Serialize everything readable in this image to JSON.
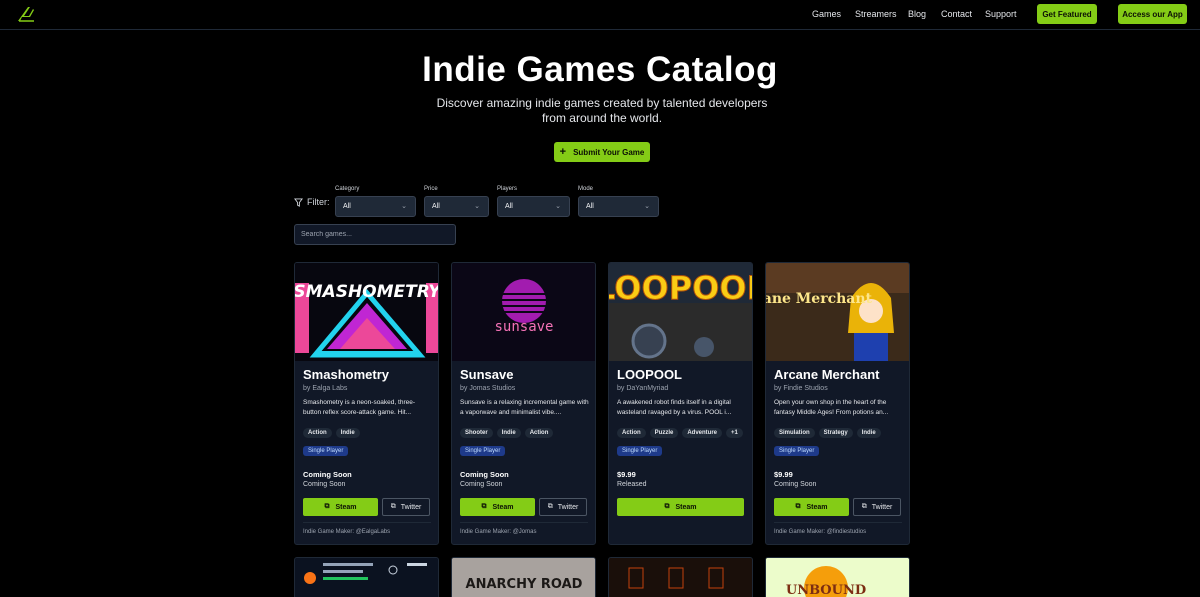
{
  "nav": {
    "items": [
      "Games",
      "Streamers",
      "Blog",
      "Contact",
      "Support"
    ],
    "get_featured": "Get Featured",
    "access_app": "Access our App"
  },
  "hero": {
    "title": "Indie Games Catalog",
    "subtitle": "Discover amazing indie games created by talented developers from around the world.",
    "submit": "Submit Your Game"
  },
  "filters": {
    "label": "Filter:",
    "groups": [
      {
        "label": "Category",
        "value": "All"
      },
      {
        "label": "Price",
        "value": "All"
      },
      {
        "label": "Players",
        "value": "All"
      },
      {
        "label": "Mode",
        "value": "All"
      }
    ],
    "search_placeholder": "Search games..."
  },
  "cards": [
    {
      "title": "Smashometry",
      "by": "by Ealga Labs",
      "desc": "Smashometry is a neon-soaked, three-button reflex score-attack game. Hit...",
      "tags": [
        "Action",
        "Indie"
      ],
      "mode": "Single Player",
      "price": "Coming Soon",
      "status": "Coming Soon",
      "steam": "Steam",
      "twitter": "Twitter",
      "maker": "Indie Game Maker: @EalgaLabs",
      "banner": "SMASHOMETRY"
    },
    {
      "title": "Sunsave",
      "by": "by Jomas Studios",
      "desc": "Sunsave is a relaxing incremental game with a vaporwave and minimalist vibe....",
      "tags": [
        "Shooter",
        "Indie",
        "Action"
      ],
      "mode": "Single Player",
      "price": "Coming Soon",
      "status": "Coming Soon",
      "steam": "Steam",
      "twitter": "Twitter",
      "maker": "Indie Game Maker: @Jomas",
      "banner": "sunsave"
    },
    {
      "title": "LOOPOOL",
      "by": "by DaYanMyriad",
      "desc": "A awakened robot finds itself in a digital wasteland ravaged by a virus. POOL i...",
      "tags": [
        "Action",
        "Puzzle",
        "Adventure",
        "+1"
      ],
      "mode": "Single Player",
      "price": "$9.99",
      "status": "Released",
      "steam": "Steam",
      "banner": "LOOPOOL"
    },
    {
      "title": "Arcane Merchant",
      "by": "by Findie Studios",
      "desc": "Open your own shop in the heart of the fantasy Middle Ages! From potions an...",
      "tags": [
        "Simulation",
        "Strategy",
        "Indie"
      ],
      "mode": "Single Player",
      "price": "$9.99",
      "status": "Coming Soon",
      "steam": "Steam",
      "twitter": "Twitter",
      "maker": "Indie Game Maker: @findiestudios",
      "banner": "Arcane Merchant"
    }
  ],
  "row2": {
    "anarchy": "ANARCHY ROAD",
    "unbound": "UNBOUND"
  },
  "colors": {
    "accent": "#84cc16",
    "bg": "#000000",
    "card": "#111827"
  }
}
